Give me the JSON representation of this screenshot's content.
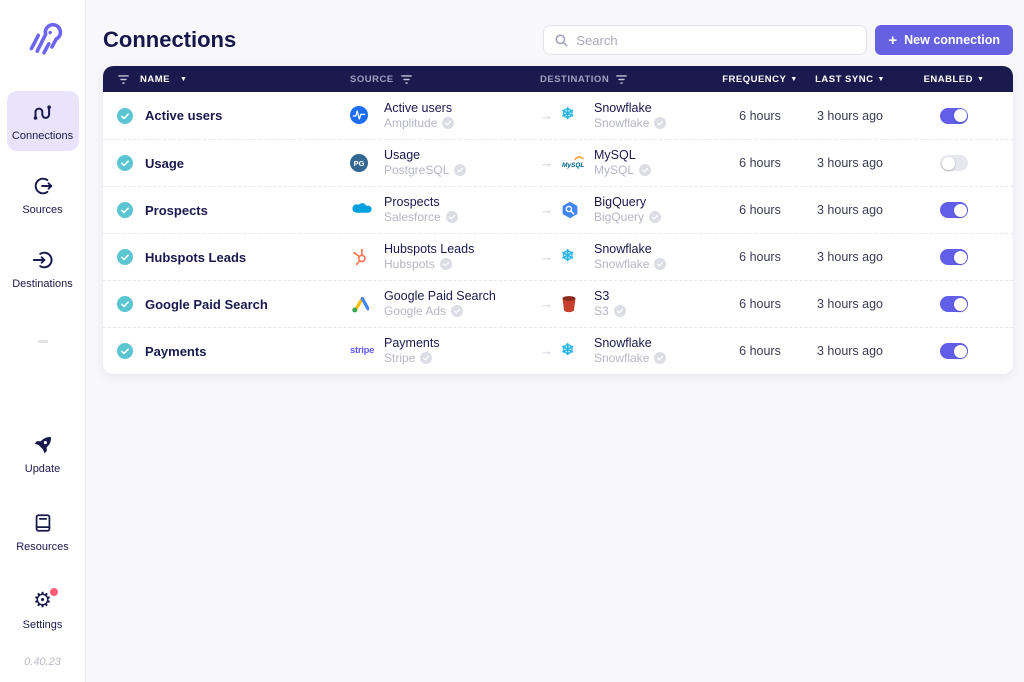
{
  "colors": {
    "accent": "#6561E2",
    "toggle_on": "#625EEA",
    "toggle_off": "#E7E7EE",
    "table_header_bg": "#1B1A4E",
    "status_check": "#5CC5D2",
    "notification_dot": "#FF5B79",
    "active_nav_bg": "#E9E4FB"
  },
  "sidebar": {
    "logo_icon": "airbyte-logo",
    "nav": [
      {
        "label": "Connections",
        "icon": "connections-icon",
        "active": true
      },
      {
        "label": "Sources",
        "icon": "source-out-icon",
        "active": false
      },
      {
        "label": "Destinations",
        "icon": "destination-in-icon",
        "active": false
      }
    ],
    "bottom_nav": [
      {
        "label": "Update",
        "icon": "rocket-icon"
      },
      {
        "label": "Resources",
        "icon": "book-icon"
      },
      {
        "label": "Settings",
        "icon": "gear-icon",
        "has_notification_dot": true
      }
    ],
    "version": "0.40.23"
  },
  "header": {
    "title": "Connections",
    "search_placeholder": "Search",
    "search_icon": "search-icon",
    "new_connection": {
      "icon": "plus-icon",
      "label": "New connection"
    }
  },
  "table": {
    "columns": [
      {
        "label": "NAME",
        "sort": true,
        "filter": true
      },
      {
        "label": "SOURCE",
        "filter": true,
        "muted": true
      },
      {
        "label": "DESTINATION",
        "filter": true,
        "muted": true
      },
      {
        "label": "FREQUENCY",
        "sort": true
      },
      {
        "label": "LAST SYNC",
        "sort": true
      },
      {
        "label": "ENABLED",
        "sort": true
      }
    ],
    "rows": [
      {
        "name": "Active users",
        "status_icon": "enabled-check",
        "source": {
          "title": "Active users",
          "connector": "Amplitude",
          "verified": true
        },
        "destination": {
          "title": "Snowflake",
          "connector": "Snowflake",
          "verified": true
        },
        "frequency": "6 hours",
        "last_sync": "3 hours ago",
        "enabled": true
      },
      {
        "name": "Usage",
        "status_icon": "enabled-check",
        "source": {
          "title": "Usage",
          "connector": "PostgreSQL",
          "verified": true
        },
        "destination": {
          "title": "MySQL",
          "connector": "MySQL",
          "verified": true
        },
        "frequency": "6 hours",
        "last_sync": "3 hours ago",
        "enabled": false
      },
      {
        "name": "Prospects",
        "status_icon": "enabled-check",
        "source": {
          "title": "Prospects",
          "connector": "Salesforce",
          "verified": true
        },
        "destination": {
          "title": "BigQuery",
          "connector": "BigQuery",
          "verified": true
        },
        "frequency": "6 hours",
        "last_sync": "3 hours ago",
        "enabled": true
      },
      {
        "name": "Hubspots Leads",
        "status_icon": "enabled-check",
        "source": {
          "title": "Hubspots Leads",
          "connector": "Hubspots",
          "verified": true
        },
        "destination": {
          "title": "Snowflake",
          "connector": "Snowflake",
          "verified": true
        },
        "frequency": "6 hours",
        "last_sync": "3 hours ago",
        "enabled": true
      },
      {
        "name": "Google Paid Search",
        "status_icon": "enabled-check",
        "source": {
          "title": "Google Paid Search",
          "connector": "Google Ads",
          "verified": true
        },
        "destination": {
          "title": "S3",
          "connector": "S3",
          "verified": true
        },
        "frequency": "6 hours",
        "last_sync": "3 hours ago",
        "enabled": true
      },
      {
        "name": "Payments",
        "status_icon": "enabled-check",
        "source": {
          "title": "Payments",
          "connector": "Stripe",
          "verified": true
        },
        "destination": {
          "title": "Snowflake",
          "connector": "Snowflake",
          "verified": true
        },
        "frequency": "6 hours",
        "last_sync": "3 hours ago",
        "enabled": true
      }
    ]
  }
}
